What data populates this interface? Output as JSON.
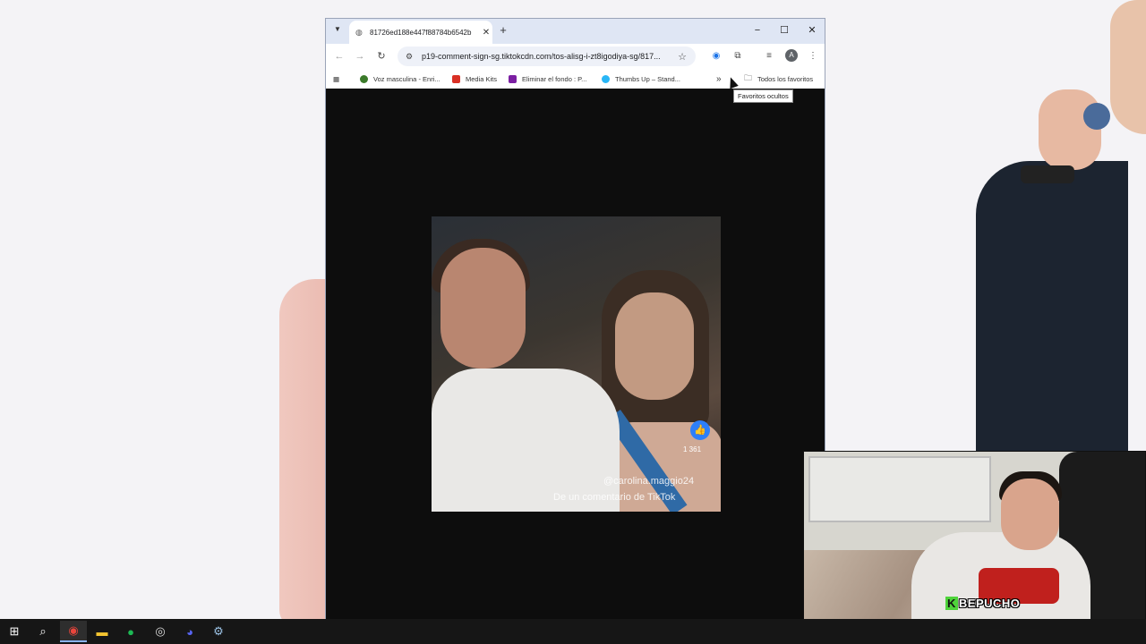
{
  "browser": {
    "tab_title": "81726ed188e447f88784b6542b",
    "url": "p19-comment-sign-sg.tiktokcdn.com/tos-alisg-i-zt8igodiya-sg/817...",
    "tooltip": "Favoritos ocultos",
    "bookmarks": [
      {
        "label": "Voz masculina - Enri...",
        "icon": "circle-icon",
        "color": "#3b7a2a"
      },
      {
        "label": "Media Kits",
        "icon": "gmail-icon",
        "color": "#d93025"
      },
      {
        "label": "Eliminar el fondo : P...",
        "icon": "app-icon",
        "color": "#7b1fa2"
      },
      {
        "label": "Thumbs Up – Stand...",
        "icon": "sparkle-icon",
        "color": "#29b6f6"
      }
    ],
    "all_bookmarks_label": "Todos los favoritos",
    "avatar_letter": "A"
  },
  "video": {
    "like_count": "1 361",
    "handle": "@carolina.maggio24",
    "caption": "De un comentario de TikTok"
  },
  "stream_overlay": {
    "logo_letter": "K",
    "logo_text": "BEPUCHO"
  },
  "taskbar": {
    "items": [
      "windows-start",
      "search",
      "chrome",
      "file-explorer",
      "spotify",
      "obs",
      "discord",
      "steam"
    ]
  },
  "colors": {
    "accent": "#2d7ff9",
    "tabstrip": "#dfe6f4",
    "taskbar": "#161616"
  }
}
